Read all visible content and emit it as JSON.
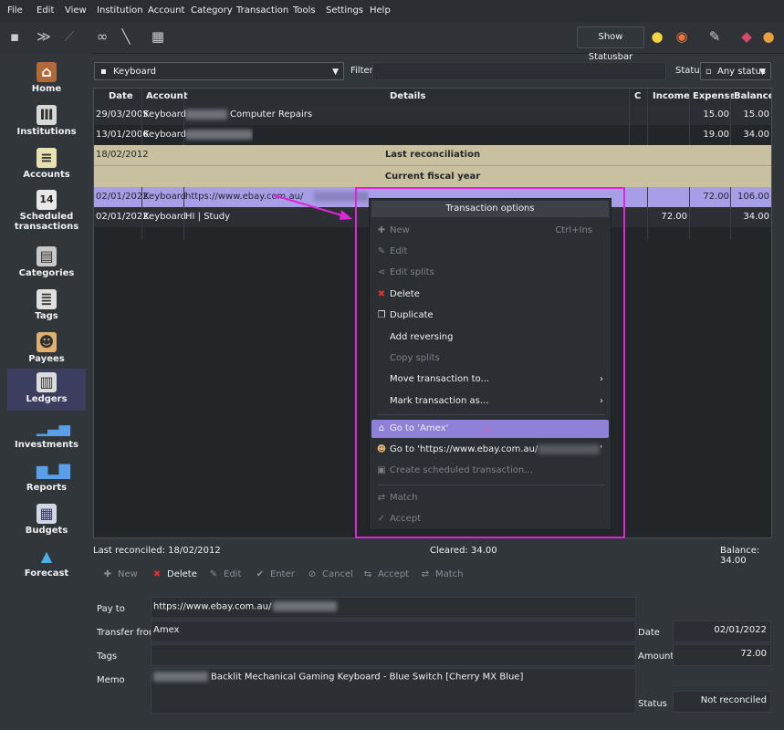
{
  "menubar": {
    "items": [
      "File",
      "Edit",
      "View",
      "Institution",
      "Account",
      "Category",
      "Transaction",
      "Tools",
      "Settings",
      "Help"
    ]
  },
  "toolbar": {
    "show_statusbar": "Show Statusbar"
  },
  "sidebar": {
    "items": [
      {
        "label": "Home",
        "icon": "home-icon"
      },
      {
        "label": "Institutions",
        "icon": "institution-icon"
      },
      {
        "label": "Accounts",
        "icon": "accounts-icon"
      },
      {
        "label": "Scheduled transactions",
        "icon": "calendar-icon",
        "badge": "14"
      },
      {
        "label": "Categories",
        "icon": "categories-icon"
      },
      {
        "label": "Tags",
        "icon": "tags-icon"
      },
      {
        "label": "Payees",
        "icon": "payees-icon"
      },
      {
        "label": "Ledgers",
        "icon": "ledgers-icon"
      },
      {
        "label": "Investments",
        "icon": "investments-icon"
      },
      {
        "label": "Reports",
        "icon": "reports-icon"
      },
      {
        "label": "Budgets",
        "icon": "budgets-icon"
      },
      {
        "label": "Forecast",
        "icon": "forecast-icon"
      }
    ]
  },
  "filterbar": {
    "account": "Keyboard",
    "filter_label": "Filter:",
    "status_label": "Status",
    "status_value": "Any status"
  },
  "ledger": {
    "columns": [
      "Date",
      "Account",
      "Details",
      "C",
      "Income",
      "Expense",
      "Balance"
    ],
    "rows": [
      {
        "date": "29/03/2005",
        "account": "Keyboard",
        "details": "Computer Repairs",
        "c": "",
        "income": "",
        "expense": "15.00",
        "balance": "15.00"
      },
      {
        "date": "13/01/2006",
        "account": "Keyboard",
        "details": "",
        "c": "",
        "income": "",
        "expense": "19.00",
        "balance": "34.00"
      }
    ],
    "reconcile_date": "18/02/2012",
    "last_reconciliation": "Last reconciliation",
    "current_fiscal_year": "Current fiscal year",
    "rows2": [
      {
        "date": "02/01/2022",
        "account": "Keyboard",
        "details": "https://www.ebay.com.au/",
        "c": "",
        "income": "",
        "expense": "72.00",
        "balance": "106.00"
      },
      {
        "date": "02/01/2022",
        "account": "Keyboard",
        "details": "HI | Study",
        "c": "",
        "income": "72.00",
        "expense": "",
        "balance": "34.00"
      }
    ]
  },
  "context_menu": {
    "title": "Transaction options",
    "items": [
      {
        "label": "New",
        "shortcut": "Ctrl+Ins",
        "icon": "new-icon"
      },
      {
        "label": "Edit",
        "icon": "edit-icon"
      },
      {
        "label": "Edit splits",
        "icon": "split-icon"
      },
      {
        "label": "Delete",
        "icon": "delete-icon"
      },
      {
        "label": "Duplicate",
        "icon": "duplicate-icon"
      },
      {
        "label": "Add reversing",
        "icon": ""
      },
      {
        "label": "Copy splits",
        "icon": ""
      },
      {
        "label": "Move transaction to...",
        "icon": "",
        "arrow": "›"
      },
      {
        "label": "Mark transaction as...",
        "icon": "",
        "arrow": "›"
      },
      {
        "label": "Go to 'Amex'",
        "icon": "bank-icon"
      },
      {
        "label": "Go to 'https://www.ebay.com.au/",
        "suffix": "'",
        "icon": "payee-icon"
      },
      {
        "label": "Create scheduled transaction...",
        "icon": "schedule-icon"
      },
      {
        "label": "Match",
        "icon": "match-icon"
      },
      {
        "label": "Accept",
        "icon": "accept-icon"
      }
    ]
  },
  "summary": {
    "last_reconciled": "Last reconciled: 18/02/2012",
    "cleared": "Cleared: 34.00",
    "balance": "Balance: 34.00"
  },
  "editor_buttons": [
    "New",
    "Delete",
    "Edit",
    "Enter",
    "Cancel",
    "Accept",
    "Match"
  ],
  "form": {
    "pay_to_label": "Pay to",
    "pay_to": "https://www.ebay.com.au/",
    "transfer_from_label": "Transfer from",
    "transfer_from": "Amex",
    "tags_label": "Tags",
    "memo_label": "Memo",
    "memo": "Backlit Mechanical Gaming Keyboard - Blue Switch [Cherry MX Blue]",
    "date_label": "Date",
    "date": "02/01/2022",
    "amount_label": "Amount",
    "amount": "72.00",
    "status_label": "Status",
    "status": "Not reconciled"
  }
}
